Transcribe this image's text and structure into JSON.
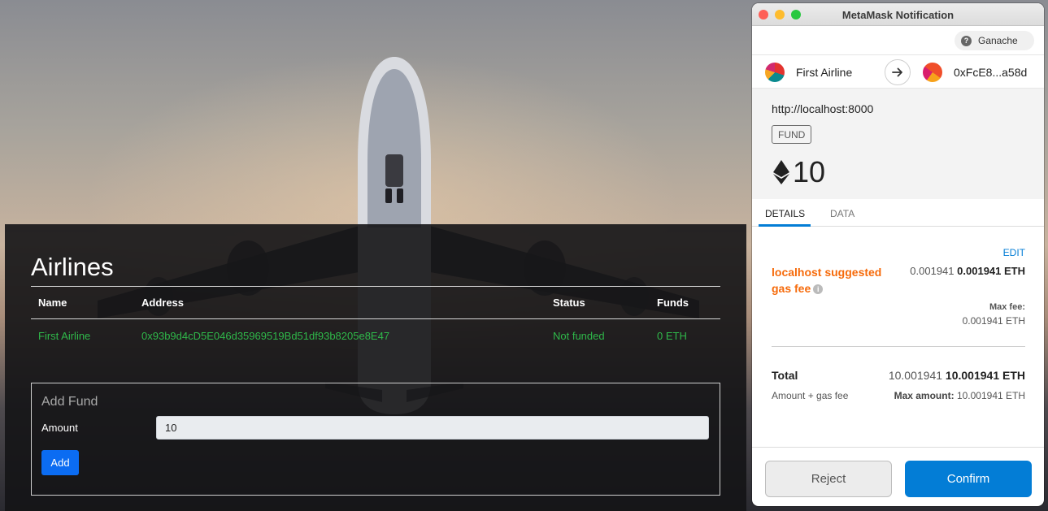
{
  "airlines_page": {
    "title": "Airlines",
    "table": {
      "headers": [
        "Name",
        "Address",
        "Status",
        "Funds"
      ],
      "rows": [
        [
          "First Airline",
          "0x93b9d4cD5E046d35969519Bd51df93b8205e8E47",
          "Not funded",
          "0 ETH"
        ]
      ]
    },
    "add_fund": {
      "title": "Add Fund",
      "amount_label": "Amount",
      "amount_value": "10",
      "add_label": "Add"
    }
  },
  "metamask": {
    "window_title": "MetaMask Notification",
    "network": "Ganache",
    "from_account": "First Airline",
    "to_account": "0xFcE8...a58d",
    "origin": "http://localhost:8000",
    "method_tag": "FUND",
    "amount": "10",
    "tabs": [
      "DETAILS",
      "DATA"
    ],
    "active_tab": "DETAILS",
    "edit_label": "EDIT",
    "gas_label": "localhost suggested gas fee",
    "gas_fee_secondary": "0.001941",
    "gas_fee_primary": "0.001941 ETH",
    "max_fee_label": "Max fee:",
    "max_fee_value": "0.001941 ETH",
    "total_label": "Total",
    "total_secondary": "10.001941",
    "total_primary": "10.001941 ETH",
    "amount_gas_label": "Amount + gas fee",
    "max_amount_label": "Max amount:",
    "max_amount_value": "10.001941 ETH",
    "reject_label": "Reject",
    "confirm_label": "Confirm",
    "colors": {
      "accent": "#037dd6",
      "gas_label": "#f66a0a",
      "table_text": "#2fb84a",
      "add_button": "#0b6cf2"
    }
  }
}
